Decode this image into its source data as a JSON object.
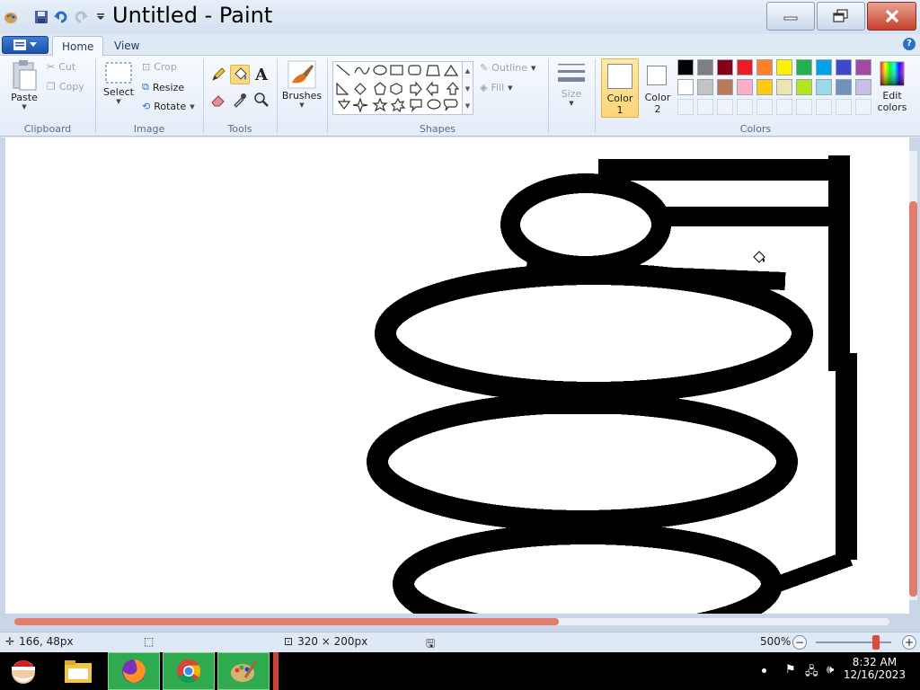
{
  "window": {
    "title": "Untitled - Paint"
  },
  "tabs": [
    {
      "label": "Home"
    },
    {
      "label": "View"
    }
  ],
  "clipboard": {
    "paste": "Paste",
    "cut": "Cut",
    "copy": "Copy",
    "group": "Clipboard"
  },
  "image": {
    "select": "Select",
    "crop": "Crop",
    "resize": "Resize",
    "rotate": "Rotate",
    "group": "Image"
  },
  "tools": {
    "group": "Tools",
    "items": [
      "pencil-icon",
      "fill-icon",
      "text-icon",
      "eraser-icon",
      "color-picker-icon",
      "magnifier-icon"
    ]
  },
  "brushes": {
    "label": "Brushes"
  },
  "shapes": {
    "outline": "Outline",
    "fill": "Fill",
    "group": "Shapes"
  },
  "size": {
    "label": "Size"
  },
  "colors": {
    "color1": "Color\n1",
    "color1_line1": "Color",
    "color1_line2": "1",
    "color2_line1": "Color",
    "color2_line2": "2",
    "edit_line1": "Edit",
    "edit_line2": "colors",
    "group": "Colors",
    "color1_value": "#ffffff",
    "color2_value": "#ffffff",
    "palette_row1": [
      "#000000",
      "#7f7f7f",
      "#880015",
      "#ed1c24",
      "#ff7f27",
      "#fff200",
      "#22b14c",
      "#00a2e8",
      "#3f48cc",
      "#a349a4"
    ],
    "palette_row2": [
      "#ffffff",
      "#c3c3c3",
      "#b97a57",
      "#ffaec9",
      "#ffc90e",
      "#efe4b0",
      "#b5e61d",
      "#99d9ea",
      "#7092be",
      "#c8bfe7"
    ]
  },
  "status": {
    "cursor_pos": "166, 48px",
    "canvas_size": "320 × 200px",
    "zoom": "500%",
    "zoom_fraction": 0.8
  },
  "taskbar": {
    "time": "8:32 AM",
    "date": "12/16/2023",
    "apps": [
      "santa-icon",
      "file-explorer-icon",
      "firefox-icon",
      "chrome-icon",
      "paint-icon"
    ]
  }
}
